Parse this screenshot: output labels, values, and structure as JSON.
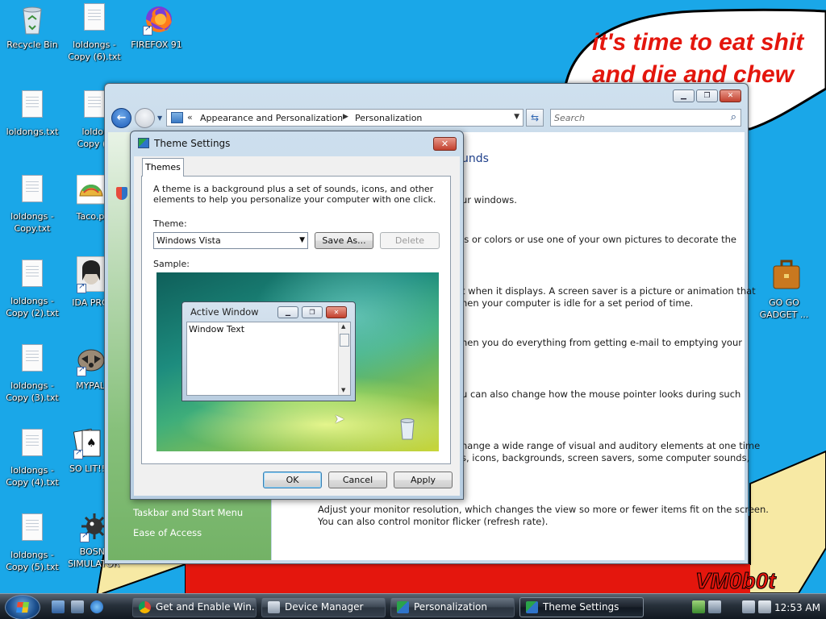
{
  "wallpaper": {
    "sky_color": "#1aa7e8",
    "red_color": "#e4160d",
    "cream_color": "#f7e9a4",
    "speech_line1": "it's time to eat shit",
    "speech_line2": "and die and chew",
    "signature": "VM0b0t"
  },
  "desktop_icons": [
    {
      "label_1": "Recycle Bin",
      "label_2": "",
      "icon": "recycle-bin-icon"
    },
    {
      "label_1": "loldongs -",
      "label_2": "Copy (6).txt",
      "icon": "text-file-icon"
    },
    {
      "label_1": "FIREFOX 91",
      "label_2": "",
      "icon": "firefox-icon"
    },
    {
      "label_1": "loldongs.txt",
      "label_2": "",
      "icon": "text-file-icon"
    },
    {
      "label_1": "loldor",
      "label_2": "Copy (7",
      "icon": "text-file-icon"
    },
    {
      "label_1": "loldongs -",
      "label_2": "Copy.txt",
      "icon": "text-file-icon"
    },
    {
      "label_1": "Taco.p",
      "label_2": "",
      "icon": "taco-icon"
    },
    {
      "label_1": "loldongs -",
      "label_2": "Copy (2).txt",
      "icon": "text-file-icon"
    },
    {
      "label_1": "IDA PRO",
      "label_2": "",
      "icon": "ida-pro-icon"
    },
    {
      "label_1": "loldongs -",
      "label_2": "Copy (3).txt",
      "icon": "text-file-icon"
    },
    {
      "label_1": "MYPAL",
      "label_2": "",
      "icon": "raccoon-icon"
    },
    {
      "label_1": "loldongs -",
      "label_2": "Copy (4).txt",
      "icon": "text-file-icon"
    },
    {
      "label_1": "SO LIT!!",
      "label_2": "",
      "icon": "cards-icon"
    },
    {
      "label_1": "loldongs -",
      "label_2": "Copy (5).txt",
      "icon": "text-file-icon"
    },
    {
      "label_1": "BOSNI",
      "label_2": "SIMULATOR",
      "icon": "mine-icon"
    },
    {
      "label_1": "GO GO",
      "label_2": "GADGET ...",
      "icon": "briefcase-icon"
    }
  ],
  "explorer": {
    "breadcrumb": [
      "Appearance and Personalization",
      "Personalization"
    ],
    "search_placeholder": "Search",
    "left_tasks": [
      "Taskbar and Start Menu",
      "Ease of Access"
    ],
    "heading_fragment": "unds",
    "descriptions": [
      "ur windows.",
      "ls or colors or use one of your own pictures to decorate the",
      "t when it displays. A screen saver is a picture or animation that",
      "hen your computer is idle for a set period of time.",
      "hen you do everything from getting e-mail to emptying your",
      "u can also change how the mouse pointer looks during such",
      "hange a wide range of visual and auditory elements at one time",
      "s, icons, backgrounds, screen savers, some computer sounds,",
      "Adjust your monitor resolution, which changes the view so more or fewer items fit on the screen.",
      "You can also control monitor flicker (refresh rate)."
    ]
  },
  "theme_dialog": {
    "title": "Theme Settings",
    "tab_label": "Themes",
    "intro_line1": "A theme is a background plus a set of sounds, icons, and other",
    "intro_line2": "elements to help you personalize your computer with one click.",
    "theme_label": "Theme:",
    "theme_value": "Windows Vista",
    "save_as_label": "Save As...",
    "delete_label": "Delete",
    "sample_label": "Sample:",
    "sample_window_title": "Active Window",
    "sample_window_text": "Window Text",
    "ok_label": "OK",
    "cancel_label": "Cancel",
    "apply_label": "Apply"
  },
  "taskbar": {
    "buttons": [
      {
        "label": "Get and Enable Win...",
        "icon": "chrome-icon",
        "active": false
      },
      {
        "label": "Device Manager",
        "icon": "device-manager-icon",
        "active": false
      },
      {
        "label": "Personalization",
        "icon": "personalization-icon",
        "active": false
      },
      {
        "label": "Theme Settings",
        "icon": "theme-settings-icon",
        "active": true
      }
    ],
    "clock": "12:53 AM"
  }
}
